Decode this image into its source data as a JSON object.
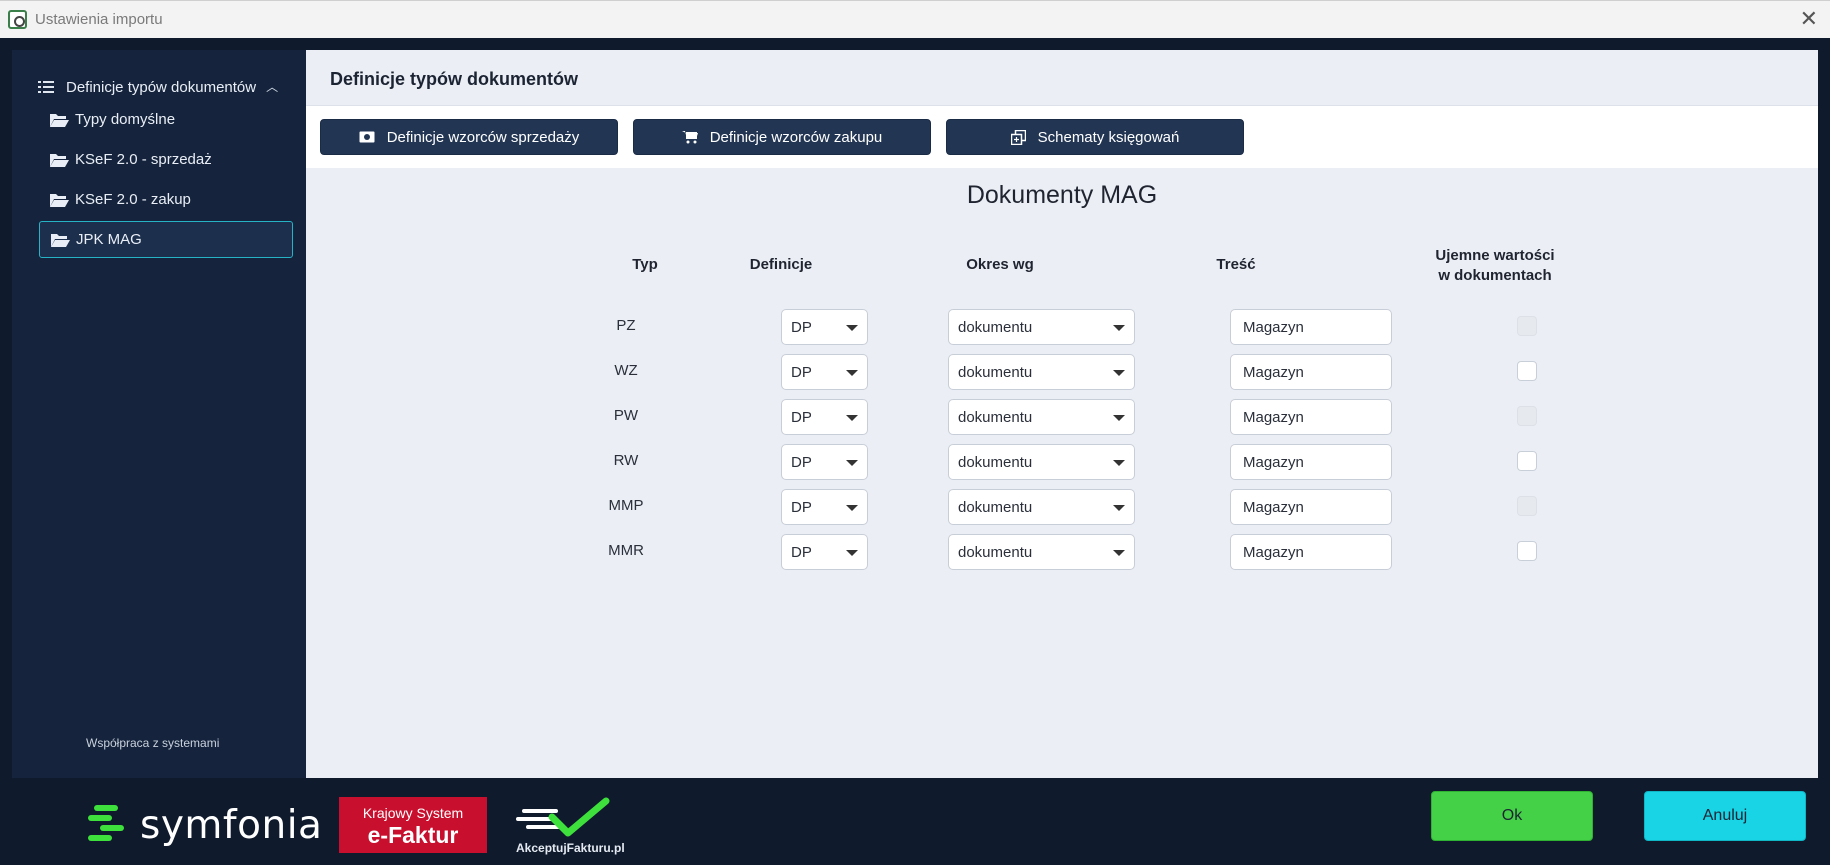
{
  "window": {
    "title": "Ustawienia importu"
  },
  "sidebar": {
    "header_label": "Definicje typów dokumentów",
    "items": [
      {
        "label": "Typy domyślne"
      },
      {
        "label": "KSeF 2.0 - sprzedaż"
      },
      {
        "label": "KSeF 2.0 - zakup"
      },
      {
        "label": "JPK MAG",
        "active": true
      }
    ]
  },
  "main": {
    "heading": "Definicje typów dokumentów",
    "toolbar": {
      "sales_label": "Definicje wzorców sprzedaży",
      "purchase_label": "Definicje wzorców zakupu",
      "schemes_label": "Schematy księgowań"
    },
    "section_title": "Dokumenty MAG",
    "columns": {
      "typ": "Typ",
      "definicje": "Definicje",
      "okres": "Okres wg",
      "tresc": "Treść",
      "ujemne_line1": "Ujemne wartości",
      "ujemne_line2": "w dokumentach"
    },
    "rows": [
      {
        "typ": "PZ",
        "definicje": "DP",
        "okres": "dokumentu",
        "tresc": "Magazyn",
        "ujemne_enabled": false,
        "ujemne_checked": false
      },
      {
        "typ": "WZ",
        "definicje": "DP",
        "okres": "dokumentu",
        "tresc": "Magazyn",
        "ujemne_enabled": true,
        "ujemne_checked": false
      },
      {
        "typ": "PW",
        "definicje": "DP",
        "okres": "dokumentu",
        "tresc": "Magazyn",
        "ujemne_enabled": false,
        "ujemne_checked": false
      },
      {
        "typ": "RW",
        "definicje": "DP",
        "okres": "dokumentu",
        "tresc": "Magazyn",
        "ujemne_enabled": true,
        "ujemne_checked": false
      },
      {
        "typ": "MMP",
        "definicje": "DP",
        "okres": "dokumentu",
        "tresc": "Magazyn",
        "ujemne_enabled": false,
        "ujemne_checked": false
      },
      {
        "typ": "MMR",
        "definicje": "DP",
        "okres": "dokumentu",
        "tresc": "Magazyn",
        "ujemne_enabled": true,
        "ujemne_checked": false
      }
    ]
  },
  "footer": {
    "cooperation_label": "Współpraca z systemami",
    "symfonia_text": "symfonia",
    "efaktur_line1": "Krajowy System",
    "efaktur_line2": "e-Faktur",
    "akceptuj_text": "AkceptujFakturu.pl",
    "ok_label": "Ok",
    "cancel_label": "Anuluj"
  },
  "colors": {
    "background": "#0f1b2d",
    "sidebar": "#15243c",
    "panel": "#ebeff5",
    "toolbar_button": "#223654",
    "ok_button": "#45d147",
    "cancel_button": "#18d4e5",
    "active_border": "#26b3c6",
    "efaktur_red": "#c8102e"
  }
}
